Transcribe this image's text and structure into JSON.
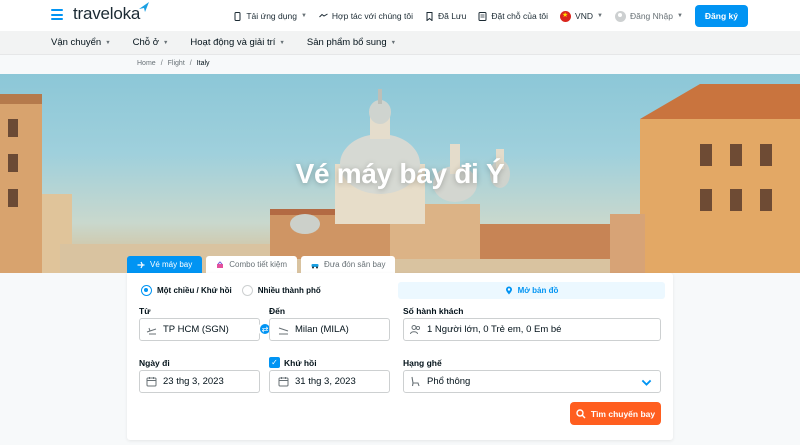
{
  "header": {
    "logo": "traveloka",
    "links": {
      "app": "Tải ứng dụng",
      "partner": "Hợp tác với chúng tôi",
      "saved": "Đã Lưu",
      "bookings": "Đặt chỗ của tôi",
      "currency": "VND",
      "login": "Đăng Nhập",
      "register": "Đăng ký"
    }
  },
  "nav": {
    "items": [
      {
        "label": "Vận chuyển"
      },
      {
        "label": "Chỗ ở"
      },
      {
        "label": "Hoạt động và giải trí"
      },
      {
        "label": "Sản phẩm bổ sung"
      }
    ]
  },
  "breadcrumb": [
    "Home",
    "Flight",
    "Italy"
  ],
  "hero": {
    "title": "Vé máy bay đi Ý"
  },
  "tabs": [
    {
      "label": "Vé máy bay",
      "active": true
    },
    {
      "label": "Combo tiết kiệm",
      "active": false
    },
    {
      "label": "Đưa đón sân bay",
      "active": false
    }
  ],
  "search": {
    "trip_type": {
      "one_way": "Một chiều / Khứ hồi",
      "multi_city": "Nhiều thành phố"
    },
    "map_button": "Mở bản đồ",
    "from": {
      "label": "Từ",
      "value": "TP HCM (SGN)"
    },
    "to": {
      "label": "Đến",
      "value": "Milan (MILA)"
    },
    "passengers": {
      "label": "Số hành khách",
      "value": "1 Người lớn, 0 Trẻ em, 0 Em bé"
    },
    "depart": {
      "label": "Ngày đi",
      "value": "23 thg 3, 2023"
    },
    "return": {
      "label": "Khứ hồi",
      "value": "31 thg 3, 2023",
      "checked": true
    },
    "seat_class": {
      "label": "Hạng ghế",
      "value": "Phổ thông"
    },
    "submit": "Tìm chuyến bay"
  },
  "colors": {
    "primary": "#0194f3",
    "cta": "#ff5e1f"
  }
}
